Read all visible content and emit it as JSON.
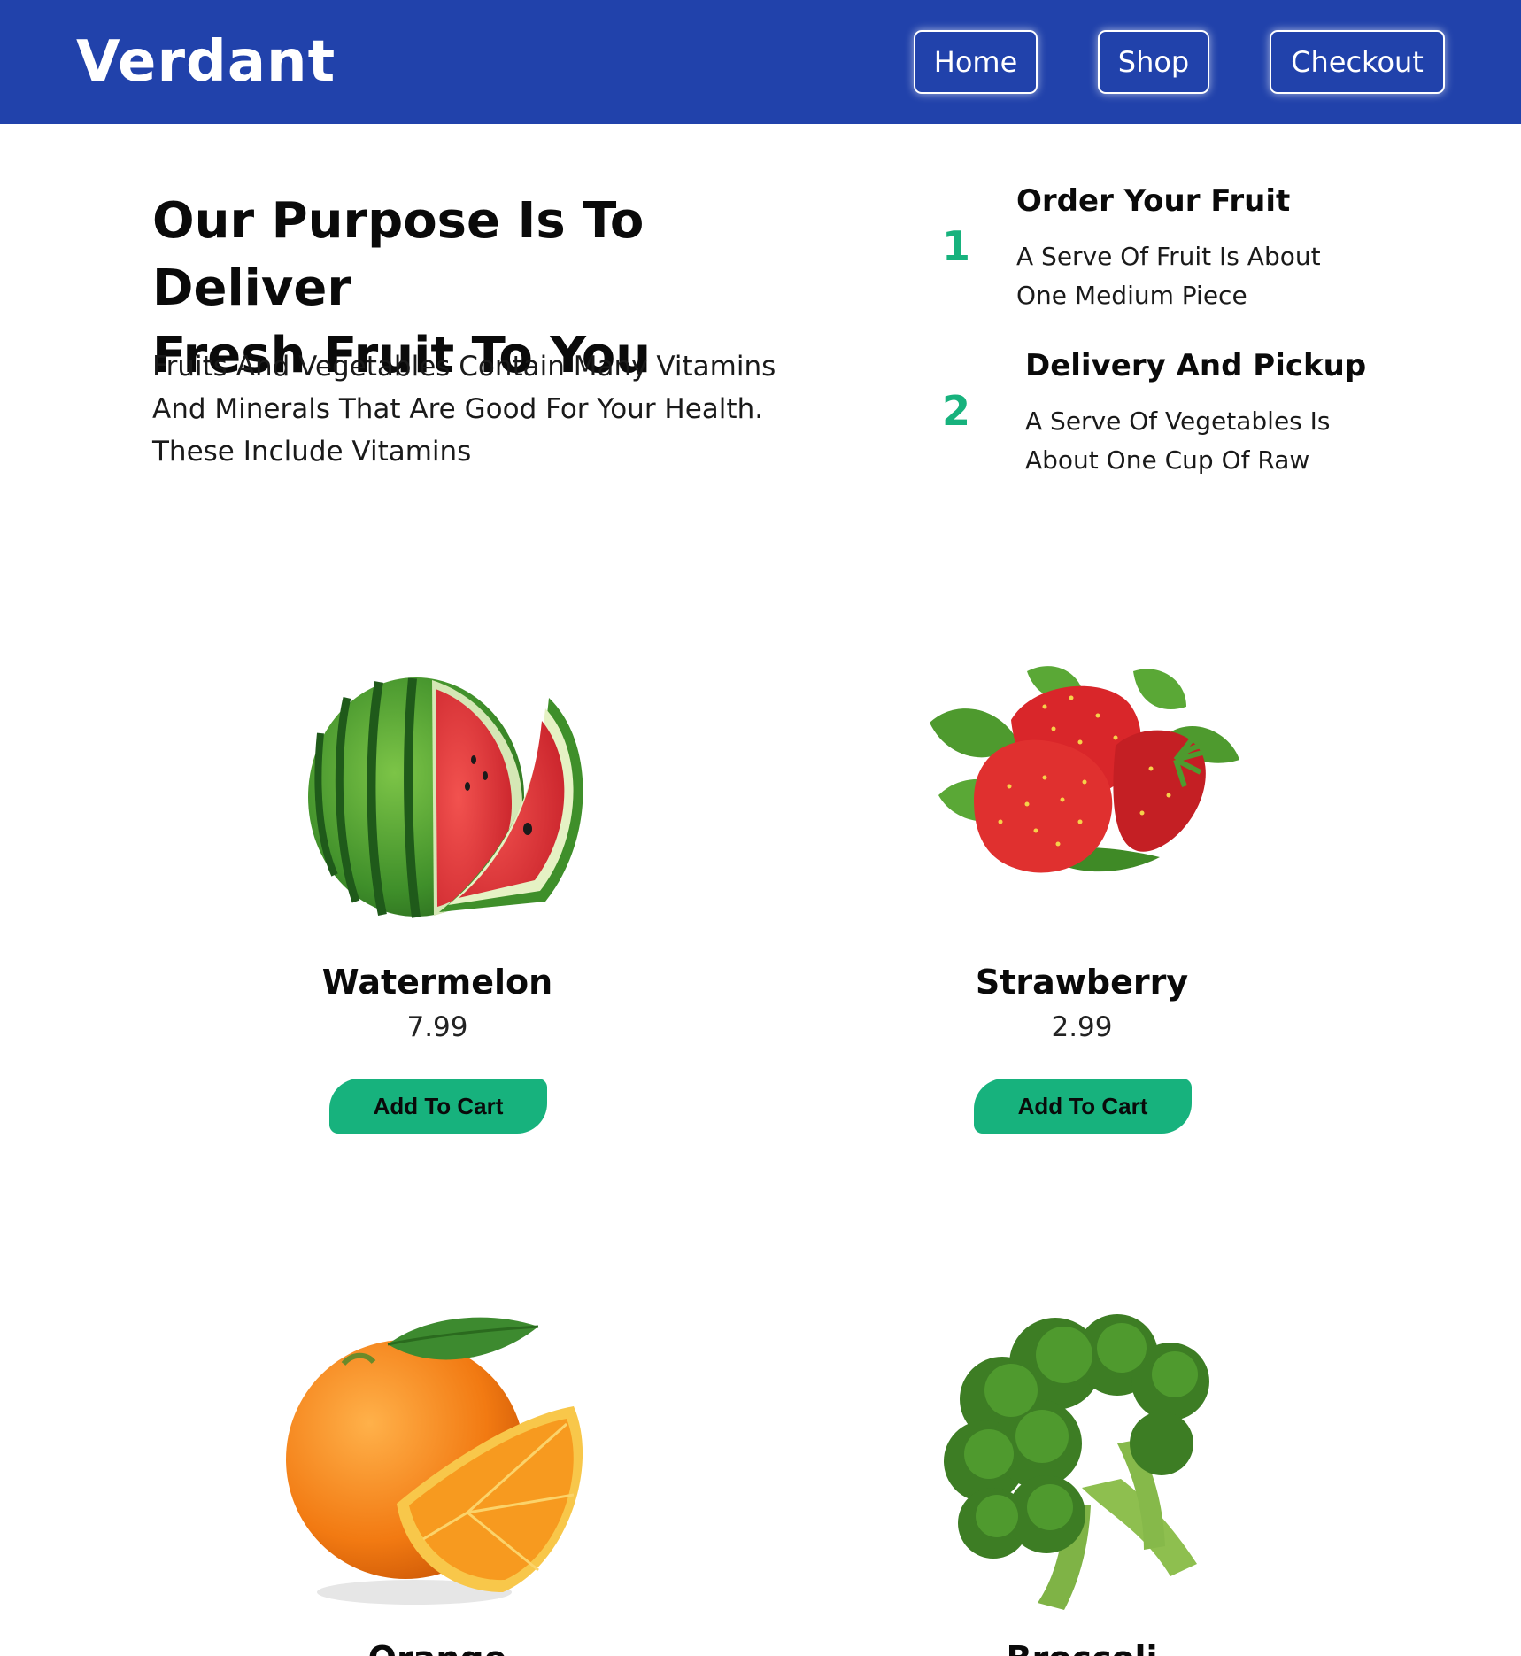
{
  "header": {
    "brand": "Verdant",
    "nav": {
      "home": "Home",
      "shop": "Shop",
      "checkout": "Checkout"
    }
  },
  "hero": {
    "title_line1": "Our Purpose Is To Deliver",
    "title_line2": "Fresh Fruit To You",
    "text_line1": "Fruits And Vegetables Contain Many Vitamins",
    "text_line2": "And Minerals That Are Good For Your Health.",
    "text_line3": "These Include Vitamins"
  },
  "steps": [
    {
      "number": "1",
      "title": "Order Your Fruit",
      "text_line1": "A Serve Of Fruit Is About",
      "text_line2": "One Medium Piece"
    },
    {
      "number": "2",
      "title": "Delivery And Pickup",
      "text_line1": "A Serve Of Vegetables Is",
      "text_line2": "About One Cup Of Raw"
    }
  ],
  "products": [
    {
      "name": "Watermelon",
      "price": "7.99",
      "button": "Add To Cart",
      "icon": "watermelon-image"
    },
    {
      "name": "Strawberry",
      "price": "2.99",
      "button": "Add To Cart",
      "icon": "strawberry-image"
    },
    {
      "name": "Orange",
      "price": "",
      "button": "",
      "icon": "orange-image"
    },
    {
      "name": "Broccoli",
      "price": "",
      "button": "",
      "icon": "broccoli-image"
    }
  ],
  "colors": {
    "header_bg": "#2142ab",
    "accent_green": "#17b27d",
    "text_dark": "#0a0a0a"
  }
}
